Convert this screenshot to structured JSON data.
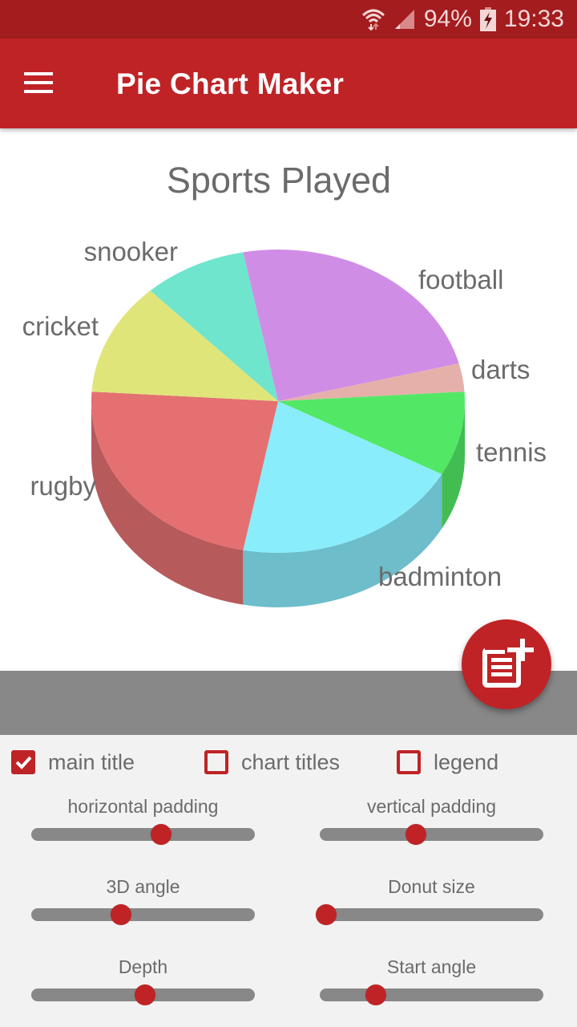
{
  "status_bar": {
    "battery": "94%",
    "time": "19:33",
    "icons": [
      "wifi-icon",
      "signal-icon",
      "battery-charging-icon"
    ]
  },
  "app_bar": {
    "title": "Pie Chart Maker",
    "menu_icon": "hamburger-menu-icon"
  },
  "chart_data": {
    "type": "pie",
    "style": "3d",
    "title": "Sports Played",
    "categories": [
      "football",
      "darts",
      "tennis",
      "badminton",
      "rugby",
      "cricket",
      "snooker"
    ],
    "values": [
      24,
      3,
      9,
      20,
      23,
      12,
      9
    ],
    "colors": [
      "#d08de6",
      "#e6b0aa",
      "#52e866",
      "#8aedfb",
      "#e57072",
      "#e0e57a",
      "#6fe5cd"
    ],
    "side_colors": [
      "#a56fb8",
      "#b88d88",
      "#42bd52",
      "#6dbdcb",
      "#b75a5c",
      "#b3b862",
      "#59b7a4"
    ],
    "legend": false
  },
  "fab": {
    "icon": "add-note-icon"
  },
  "controls": {
    "checkboxes": [
      {
        "label": "main title",
        "checked": true
      },
      {
        "label": "chart titles",
        "checked": false
      },
      {
        "label": "legend",
        "checked": false
      }
    ],
    "sliders": [
      {
        "label": "horizontal padding",
        "value": 0.58
      },
      {
        "label": "vertical padding",
        "value": 0.43
      },
      {
        "label": "3D angle",
        "value": 0.4
      },
      {
        "label": "Donut size",
        "value": 0.03
      },
      {
        "label": "Depth",
        "value": 0.51
      },
      {
        "label": "Start angle",
        "value": 0.25
      }
    ]
  }
}
